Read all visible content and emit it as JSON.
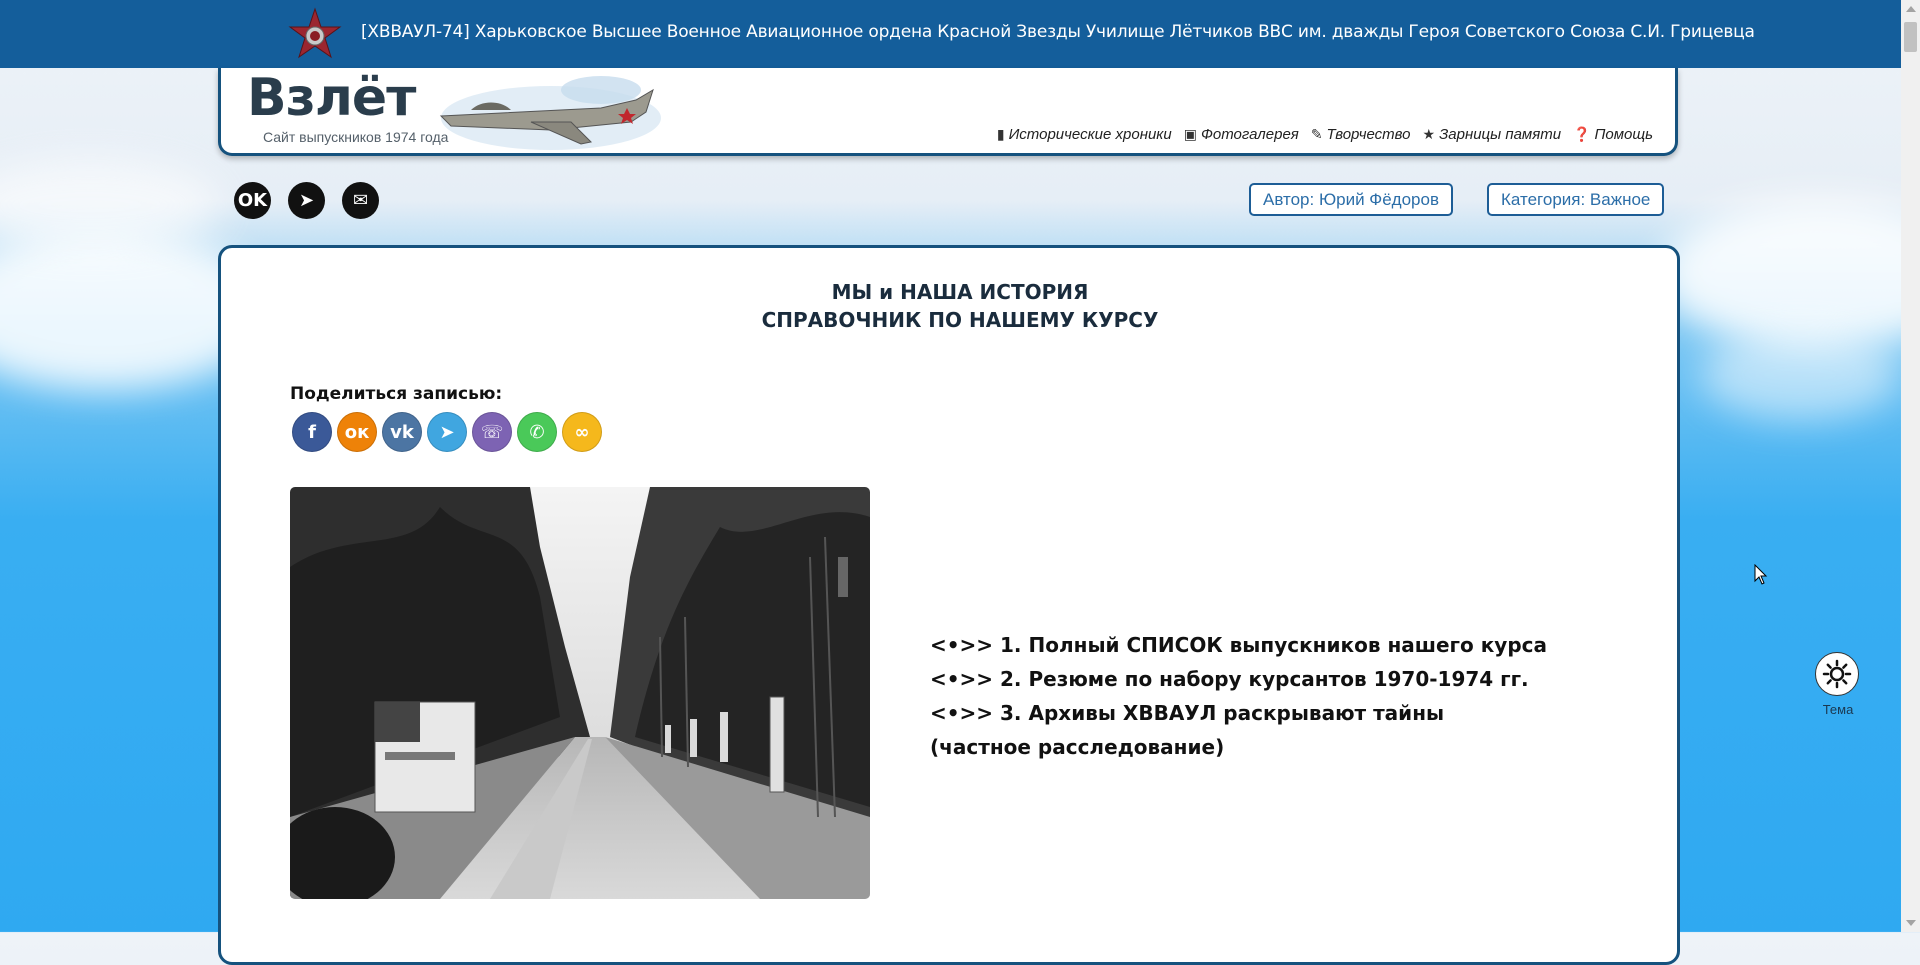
{
  "site_title": "[ХВВАУЛ-74] Харьковское Высшее Военное Авиационное ордена Красной Звезды Училище Лётчиков ВВС им. дважды Героя Советского Союза С.И. Грицевца",
  "brand": "Взлёт",
  "tagline": "Сайт выпускников 1974 года",
  "nav": [
    {
      "icon": "book-icon",
      "label": "Исторические хроники"
    },
    {
      "icon": "image-icon",
      "label": "Фотогалерея"
    },
    {
      "icon": "pencil-icon",
      "label": "Творчество"
    },
    {
      "icon": "star-icon",
      "label": "Зарницы памяти"
    },
    {
      "icon": "question-icon",
      "label": "Помощь"
    }
  ],
  "author_pill": "Автор: Юрий Фёдоров",
  "category_pill": "Категория: Важное",
  "heading_line1": "МЫ и НАША ИСТОРИЯ",
  "heading_line2": "СПРАВОЧНИК ПО НАШЕМУ КУРСУ",
  "share_label": "Поделиться записью:",
  "share_buttons": [
    {
      "name": "facebook",
      "color": "#3b5998"
    },
    {
      "name": "odnoklassniki",
      "color": "#ee8208"
    },
    {
      "name": "vk",
      "color": "#4c75a3"
    },
    {
      "name": "telegram",
      "color": "#40a6e0"
    },
    {
      "name": "viber",
      "color": "#7d63b3"
    },
    {
      "name": "whatsapp",
      "color": "#4ac959"
    },
    {
      "name": "copy-link",
      "color": "#f5b81c"
    }
  ],
  "links": [
    "<•>> 1. Полный СПИСОК выпускников нашего курса",
    "<•>> 2. Резюме по набору курсантов 1970-1974 гг.",
    "<•>> 3. Архивы ХВВАУЛ раскрывают тайны",
    "(частное расследование)"
  ],
  "theme_label": "Тема",
  "colors": {
    "topbar": "#145e9b",
    "border": "#15527e",
    "pill_text": "#2c6ea8"
  }
}
